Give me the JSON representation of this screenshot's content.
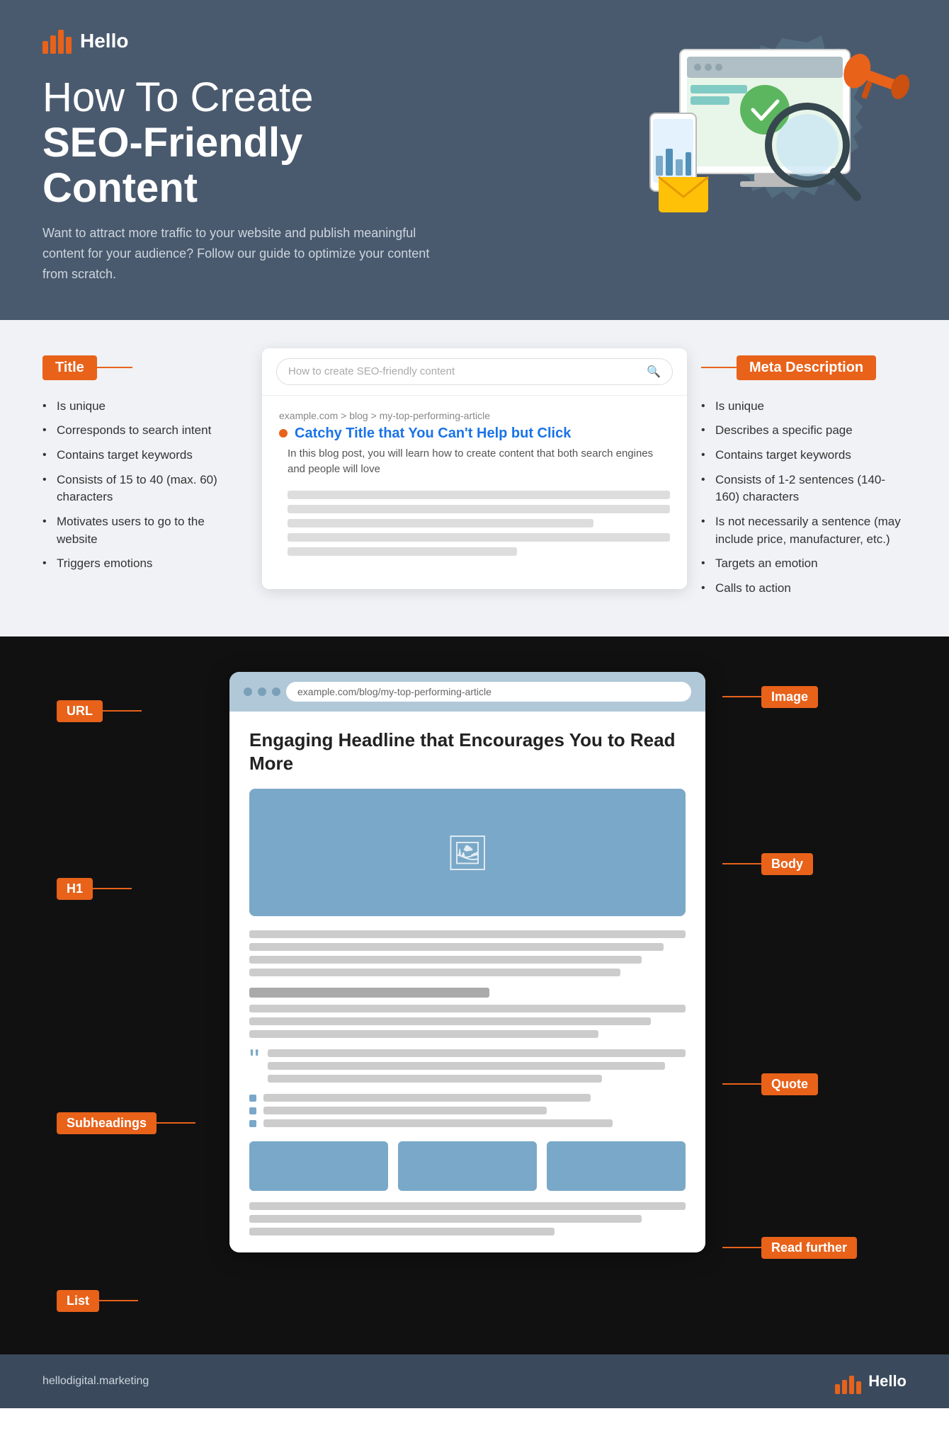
{
  "header": {
    "logo_text": "Hello",
    "title_light": "How To Create",
    "title_bold": "SEO-Friendly Content",
    "subtitle": "Want to attract more traffic to your website and publish meaningful content for your audience? Follow our guide to optimize your content from scratch."
  },
  "middle": {
    "title_label": "Title",
    "meta_label": "Meta Description",
    "search_placeholder": "How to create SEO-friendly content",
    "breadcrumb": "example.com > blog > my-top-performing-article",
    "catchy_title": "Catchy Title that You Can't Help but Click",
    "description": "In this blog post, you will learn how to create content that both search engines and people will love",
    "title_bullets": [
      "Is unique",
      "Corresponds to search intent",
      "Contains target keywords",
      "Consists of 15 to 40 (max. 60) characters",
      "Motivates users to go to the website",
      "Triggers emotions"
    ],
    "meta_bullets": [
      "Is unique",
      "Describes a specific page",
      "Contains target keywords",
      "Consists of 1-2 sentences (140-160) characters",
      "Is not necessarily a sentence (may include price, manufacturer, etc.)",
      "Targets an emotion",
      "Calls to action"
    ]
  },
  "bottom": {
    "url_label": "URL",
    "h1_label": "H1",
    "subheadings_label": "Subheadings",
    "list_label": "List",
    "image_label": "Image",
    "body_label": "Body",
    "quote_label": "Quote",
    "read_further_label": "Read further",
    "blog_url": "example.com/blog/my-top-performing-article",
    "blog_headline": "Engaging Headline that Encourages You to Read More"
  },
  "footer": {
    "url": "hellodigital.marketing",
    "logo_text": "Hello"
  }
}
